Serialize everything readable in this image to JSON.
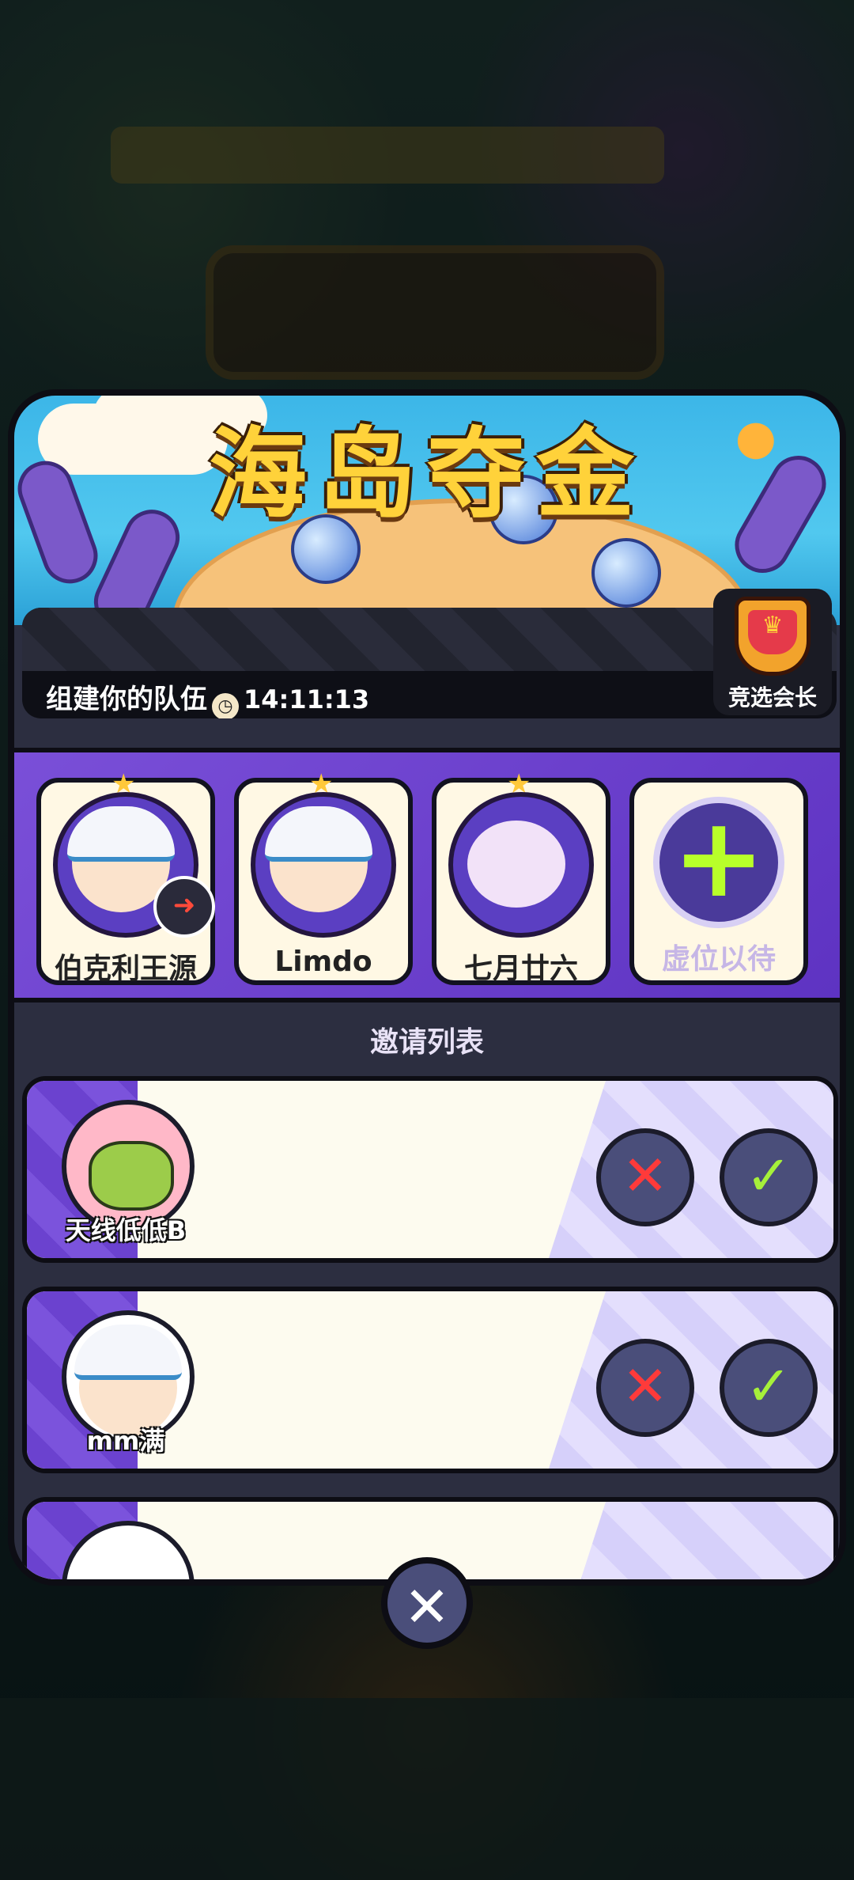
{
  "event": {
    "title": "海岛夺金",
    "team_label": "组建你的队伍",
    "timer": "14:11:13",
    "captain_label": "竞选会长"
  },
  "members": [
    {
      "name": "伯克利王源",
      "type": "boy",
      "has_leave_badge": true
    },
    {
      "name": "Limdo",
      "type": "boy"
    },
    {
      "name": "七月廿六",
      "type": "cat"
    },
    {
      "name": "虚位以待",
      "type": "empty"
    }
  ],
  "invite": {
    "title": "邀请列表",
    "rows": [
      {
        "name": "天线低低B"
      },
      {
        "name": "mm满"
      }
    ]
  },
  "icons": {
    "close": "close-icon",
    "accept": "check-icon",
    "reject": "x-icon",
    "add": "plus-icon"
  },
  "colors": {
    "title_gold": "#ffd23a",
    "panel_purple": "#7a4fd8",
    "accept_green": "#a6f03a",
    "reject_red": "#ff3a3a"
  }
}
